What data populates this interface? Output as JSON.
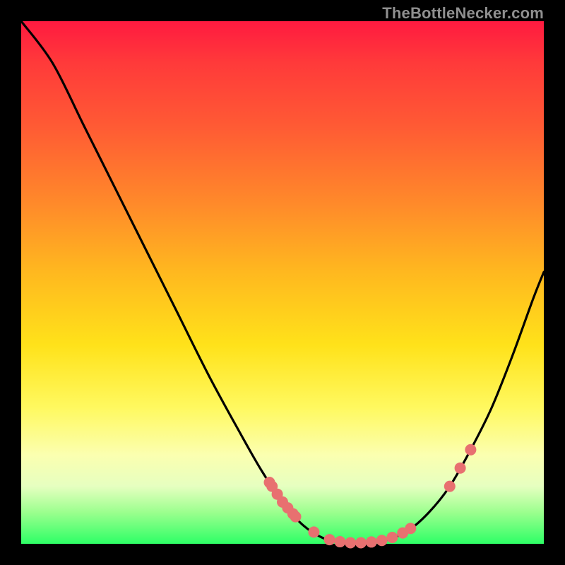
{
  "watermark": "TheBottleNecker.com",
  "curve": {
    "comment": "x in [0,1], y = bottleneck fraction (0 good, 1 bad). Curve estimated from image: steep drop, flat ~0 around x≈0.57–0.73, rise to ~0.52 at right.",
    "path_pts": [
      [
        0.0,
        0.0
      ],
      [
        0.06,
        0.08
      ],
      [
        0.12,
        0.2
      ],
      [
        0.18,
        0.32
      ],
      [
        0.24,
        0.44
      ],
      [
        0.3,
        0.56
      ],
      [
        0.36,
        0.68
      ],
      [
        0.42,
        0.79
      ],
      [
        0.46,
        0.86
      ],
      [
        0.5,
        0.92
      ],
      [
        0.54,
        0.965
      ],
      [
        0.58,
        0.99
      ],
      [
        0.62,
        0.998
      ],
      [
        0.66,
        0.998
      ],
      [
        0.7,
        0.992
      ],
      [
        0.74,
        0.975
      ],
      [
        0.78,
        0.94
      ],
      [
        0.82,
        0.89
      ],
      [
        0.86,
        0.82
      ],
      [
        0.9,
        0.74
      ],
      [
        0.94,
        0.64
      ],
      [
        0.98,
        0.53
      ],
      [
        1.0,
        0.48
      ]
    ]
  },
  "markers": {
    "comment": "salmon dots along the curve, x fraction across plot (0..1)",
    "color": "#e87070",
    "radius": 8,
    "xs": [
      0.475,
      0.48,
      0.49,
      0.5,
      0.51,
      0.52,
      0.525,
      0.56,
      0.59,
      0.61,
      0.63,
      0.65,
      0.67,
      0.69,
      0.71,
      0.73,
      0.745,
      0.82,
      0.84,
      0.86
    ]
  },
  "chart_data": {
    "type": "line",
    "title": "",
    "xlabel": "",
    "ylabel": "",
    "xlim": [
      0,
      1
    ],
    "ylim": [
      0,
      1
    ],
    "series": [
      {
        "name": "bottleneck-curve",
        "x": [
          0.0,
          0.06,
          0.12,
          0.18,
          0.24,
          0.3,
          0.36,
          0.42,
          0.46,
          0.5,
          0.54,
          0.58,
          0.62,
          0.66,
          0.7,
          0.74,
          0.78,
          0.82,
          0.86,
          0.9,
          0.94,
          0.98,
          1.0
        ],
        "y": [
          1.0,
          0.92,
          0.8,
          0.68,
          0.56,
          0.44,
          0.32,
          0.21,
          0.14,
          0.08,
          0.035,
          0.01,
          0.002,
          0.002,
          0.008,
          0.025,
          0.06,
          0.11,
          0.18,
          0.26,
          0.36,
          0.47,
          0.52
        ]
      }
    ],
    "markers_x": [
      0.475,
      0.48,
      0.49,
      0.5,
      0.51,
      0.52,
      0.525,
      0.56,
      0.59,
      0.61,
      0.63,
      0.65,
      0.67,
      0.69,
      0.71,
      0.73,
      0.745,
      0.82,
      0.84,
      0.86
    ]
  }
}
